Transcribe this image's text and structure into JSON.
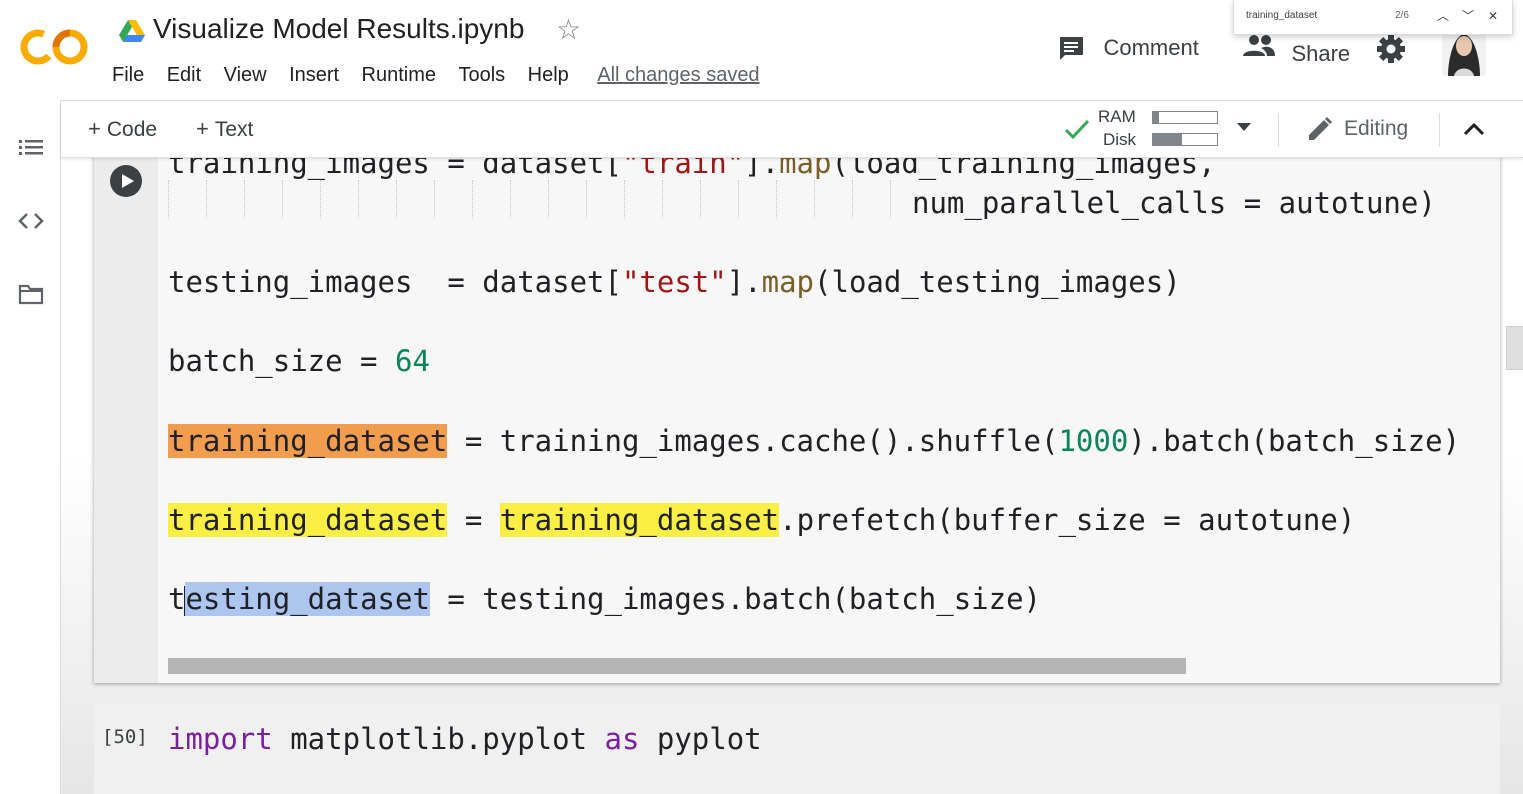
{
  "header": {
    "title": "Visualize Model Results.ipynb",
    "menu": [
      "File",
      "Edit",
      "View",
      "Insert",
      "Runtime",
      "Tools",
      "Help"
    ],
    "save_status": "All changes saved",
    "comment_label": "Comment",
    "share_label": "Share",
    "logo_colors": [
      "#f9ab00",
      "#e37400"
    ]
  },
  "find_bar": {
    "query": "training_dataset",
    "count": "2/6"
  },
  "toolbar": {
    "add_code_label": "Code",
    "add_text_label": "Text",
    "ram_label": "RAM",
    "disk_label": "Disk",
    "ram_usage": 0.1,
    "disk_usage": 0.45,
    "mode_label": "Editing",
    "status_color": "#34a853"
  },
  "sidebar": {
    "icons": [
      "table-of-contents-icon",
      "code-snippets-icon",
      "files-folder-icon"
    ]
  },
  "cells": {
    "active": {
      "line1": {
        "a": "training_images = dataset[",
        "s": "\"train\"",
        "b": "].",
        "f": "map",
        "c": "(load_training_images,"
      },
      "line2": "num_parallel_calls = autotune)",
      "line3": {
        "a": "testing_images  = dataset[",
        "s": "\"test\"",
        "b": "].",
        "f": "map",
        "c": "(load_testing_images)"
      },
      "line4": {
        "a": "batch_size = ",
        "n": "64"
      },
      "line5": {
        "h": "training_dataset",
        "a": " = training_images.cache().shuffle(",
        "n": "1000",
        "b": ").batch(batch_size)"
      },
      "line6": {
        "h1": "training_dataset",
        "a": " = ",
        "h2": "training_dataset",
        "b": ".prefetch(buffer_size = autotune)"
      },
      "line7": {
        "pre": "t",
        "sel": "esting_dataset",
        "rest": " = testing_images.batch(batch_size)"
      }
    },
    "next": {
      "exec_count": "[50]",
      "kw1": "import",
      "mod": " matplotlib.pyplot ",
      "kw2": "as",
      "alias": " pyplot"
    }
  }
}
